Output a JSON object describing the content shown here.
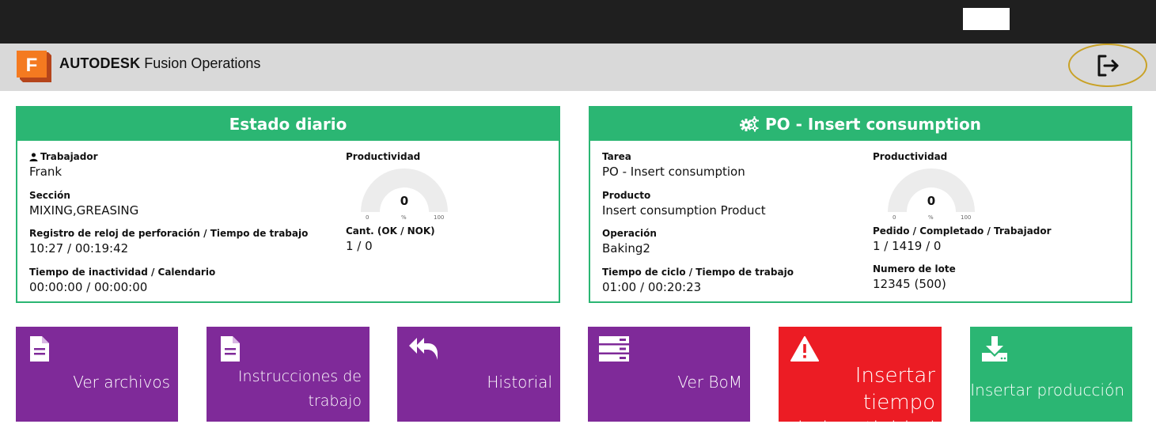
{
  "app": {
    "brand_bold": "AUTODESK",
    "brand_rest": "Fusion Operations",
    "logo_letter": "F"
  },
  "daily": {
    "title": "Estado diario",
    "worker_label": "Trabajador",
    "worker_value": "Frank",
    "section_label": "Sección",
    "section_value": "MIXING,GREASING",
    "clock_label": "Registro de reloj de perforación / Tiempo de trabajo",
    "clock_value": "10:27 / 00:19:42",
    "idle_label": "Tiempo de inactividad / Calendario",
    "idle_value": "00:00:00 / 00:00:00",
    "productivity_label": "Productividad",
    "productivity_value": "0",
    "gauge_min": "0",
    "gauge_unit": "%",
    "gauge_max": "100",
    "qty_label": "Cant. (OK / NOK)",
    "qty_value": "1 / 0"
  },
  "task": {
    "title": "PO - Insert consumption",
    "task_label": "Tarea",
    "task_value": "PO - Insert consumption",
    "product_label": "Producto",
    "product_value": "Insert consumption Product",
    "operation_label": "Operación",
    "operation_value": "Baking2",
    "cycle_label": "Tiempo de ciclo / Tiempo de trabajo",
    "cycle_value": "01:00 / 00:20:23",
    "productivity_label": "Productividad",
    "productivity_value": "0",
    "gauge_min": "0",
    "gauge_unit": "%",
    "gauge_max": "100",
    "order_label": "Pedido / Completado / Trabajador",
    "order_value": "1 / 1419 / 0",
    "lot_label": "Numero de lote",
    "lot_value": "12345 (500)"
  },
  "actions": {
    "files": "Ver archivos",
    "instructions_line1": "Instrucciones de",
    "instructions_line2": "trabajo",
    "history": "Historial",
    "bom": "Ver BoM",
    "downtime_line1": "Insertar tiempo",
    "downtime_line2": "de inactividad",
    "production": "Insertar producción"
  },
  "colors": {
    "accent_green": "#2bb673",
    "tile_purple": "#7f2a99",
    "tile_red": "#ec1c24",
    "logout_ring": "#c9a227"
  },
  "icons": {
    "logout": "logout-icon",
    "user": "user-icon",
    "gears": "gears-icon",
    "file": "file-icon",
    "reply_all": "reply-all-icon",
    "server": "server-icon",
    "warning": "warning-icon",
    "download": "download-icon"
  }
}
